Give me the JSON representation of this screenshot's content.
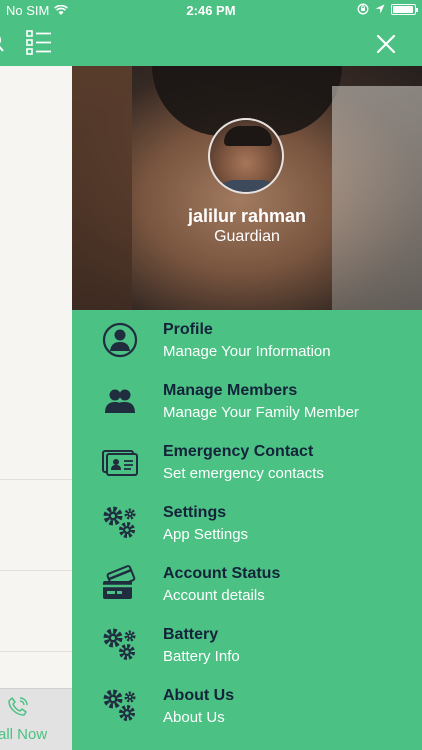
{
  "status_bar": {
    "carrier": "No SIM",
    "time": "2:46 PM",
    "battery_level": 0.95
  },
  "background_app": {
    "call_label": "all Now"
  },
  "drawer": {
    "user": {
      "name": "jalilur rahman",
      "role": "Guardian"
    },
    "menu": [
      {
        "title": "Profile",
        "subtitle": "Manage Your Information",
        "icon": "person-circle-icon"
      },
      {
        "title": "Manage Members",
        "subtitle": "Manage Your Family Member",
        "icon": "users-icon"
      },
      {
        "title": "Emergency Contact",
        "subtitle": "Set emergency contacts",
        "icon": "contact-card-icon"
      },
      {
        "title": "Settings",
        "subtitle": "App Settings",
        "icon": "gears-icon"
      },
      {
        "title": "Account Status",
        "subtitle": "Account details",
        "icon": "credit-card-icon"
      },
      {
        "title": "Battery",
        "subtitle": "Battery Info",
        "icon": "gears-icon"
      },
      {
        "title": "About Us",
        "subtitle": "About Us",
        "icon": "gears-icon"
      }
    ]
  },
  "colors": {
    "primary": "#4cc184",
    "title_text": "#13233a",
    "icon": "#1f2d3f"
  }
}
